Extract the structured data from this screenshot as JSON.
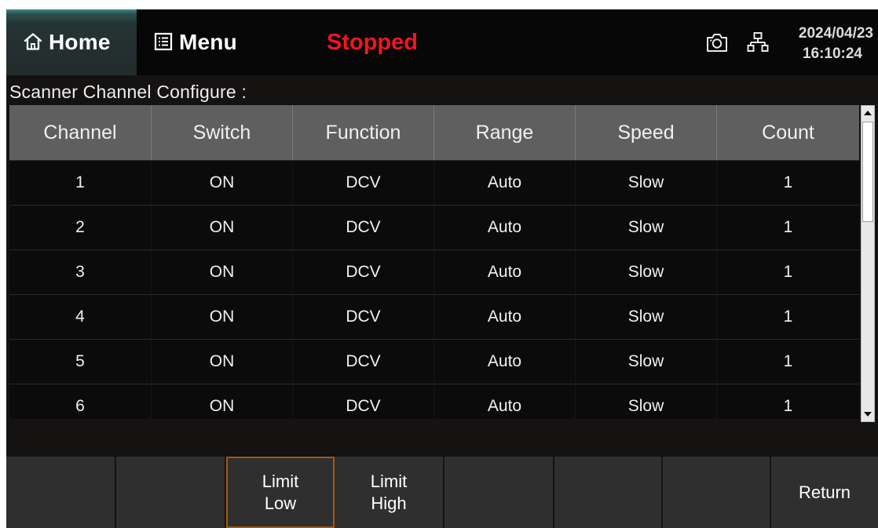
{
  "topbar": {
    "home_label": "Home",
    "menu_label": "Menu",
    "status": "Stopped",
    "date": "2024/04/23",
    "time": "16:10:24",
    "status_color": "#f5141e"
  },
  "section_title": "Scanner Channel Configure :",
  "table": {
    "headers": [
      "Channel",
      "Switch",
      "Function",
      "Range",
      "Speed",
      "Count"
    ],
    "rows": [
      [
        "1",
        "ON",
        "DCV",
        "Auto",
        "Slow",
        "1"
      ],
      [
        "2",
        "ON",
        "DCV",
        "Auto",
        "Slow",
        "1"
      ],
      [
        "3",
        "ON",
        "DCV",
        "Auto",
        "Slow",
        "1"
      ],
      [
        "4",
        "ON",
        "DCV",
        "Auto",
        "Slow",
        "1"
      ],
      [
        "5",
        "ON",
        "DCV",
        "Auto",
        "Slow",
        "1"
      ],
      [
        "6",
        "ON",
        "DCV",
        "Auto",
        "Slow",
        "1"
      ]
    ]
  },
  "softkeys": [
    {
      "line1": "",
      "line2": ""
    },
    {
      "line1": "",
      "line2": ""
    },
    {
      "line1": "Limit",
      "line2": "Low"
    },
    {
      "line1": "Limit",
      "line2": "High"
    },
    {
      "line1": "",
      "line2": ""
    },
    {
      "line1": "",
      "line2": ""
    },
    {
      "line1": "",
      "line2": ""
    },
    {
      "line1": "Return",
      "line2": ""
    }
  ],
  "icons": {
    "home": "home-icon",
    "menu": "menu-list-icon",
    "camera": "camera-icon",
    "network": "network-icon",
    "scroll_up": "arrow-up-icon",
    "scroll_down": "arrow-down-icon"
  },
  "accent_colors": {
    "active_softkey_border": "#a25a12",
    "header_row": "#5f5f5f"
  }
}
